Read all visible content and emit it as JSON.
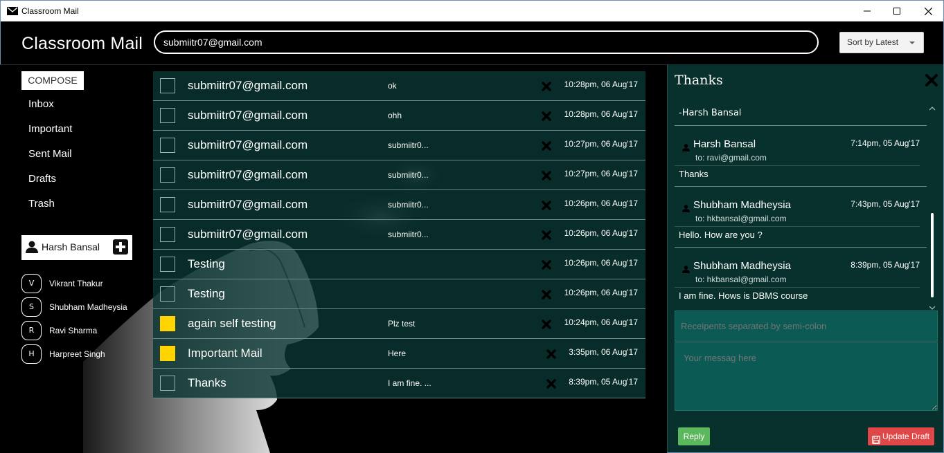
{
  "window": {
    "title": "Classroom Mail",
    "icon": "envelope-icon",
    "controls": [
      "minimize-icon",
      "maximize-icon",
      "close-icon"
    ]
  },
  "header": {
    "brand": "Classroom Mail",
    "search_value": "submiitr07@gmail.com",
    "sort_label": "Sort by Latest"
  },
  "sidebar": {
    "compose_label": "COMPOSE",
    "items": [
      "Inbox",
      "Important",
      "Sent Mail",
      "Drafts",
      "Trash"
    ],
    "current_user": "Harsh Bansal",
    "contacts": [
      {
        "initial": "V",
        "name": "Vikrant Thakur"
      },
      {
        "initial": "S",
        "name": "Shubham Madheysia"
      },
      {
        "initial": "R",
        "name": "Ravi Sharma"
      },
      {
        "initial": "H",
        "name": "Harpreet Singh"
      }
    ]
  },
  "mails": [
    {
      "from": "submiitr07@gmail.com",
      "snippet": "ok",
      "time": "10:28pm, 06 Aug'17",
      "checked": false
    },
    {
      "from": "submiitr07@gmail.com",
      "snippet": "ohh",
      "time": "10:28pm, 06 Aug'17",
      "checked": false
    },
    {
      "from": "submiitr07@gmail.com",
      "snippet": "submiitr0...",
      "time": "10:27pm, 06 Aug'17",
      "checked": false
    },
    {
      "from": "submiitr07@gmail.com",
      "snippet": "submiitr0...",
      "time": "10:27pm, 06 Aug'17",
      "checked": false
    },
    {
      "from": "submiitr07@gmail.com",
      "snippet": "submiitr0...",
      "time": "10:26pm, 06 Aug'17",
      "checked": false
    },
    {
      "from": "submiitr07@gmail.com",
      "snippet": "submiitr0...",
      "time": "10:26pm, 06 Aug'17",
      "checked": false
    },
    {
      "from": "Testing",
      "snippet": "",
      "time": "10:26pm, 06 Aug'17",
      "checked": false
    },
    {
      "from": "Testing",
      "snippet": "",
      "time": "10:26pm, 06 Aug'17",
      "checked": false
    },
    {
      "from": "again self testing",
      "snippet": "Plz test",
      "time": "10:24pm, 06 Aug'17",
      "checked": true
    },
    {
      "from": "Important Mail",
      "snippet": "Here",
      "time": "3:35pm, 06 Aug'17",
      "checked": true
    },
    {
      "from": "Thanks",
      "snippet": "I am fine. ...",
      "time": "8:39pm, 05 Aug'17",
      "checked": false
    }
  ],
  "reading_pane": {
    "subject": "Thanks",
    "signature": "-Harsh Bansal",
    "messages": [
      {
        "from": "Harsh Bansal",
        "to": "to: ravi@gmail.com",
        "time": "7:14pm, 05 Aug'17",
        "body": "Thanks"
      },
      {
        "from": "Shubham Madheysia",
        "to": "to: hkbansal@gmail.com",
        "time": "7:43pm, 05 Aug'17",
        "body": "Hello. How are you ?"
      },
      {
        "from": "Shubham Madheysia",
        "to": "to: hkbansal@gmail.com",
        "time": "8:39pm, 05 Aug'17",
        "body": "I am fine. Hows is DBMS course"
      }
    ],
    "recipients_placeholder": "Receipents separated by semi-colon",
    "message_placeholder": "Your messag here",
    "reply_label": "Reply",
    "update_draft_label": "Update Draft"
  },
  "colors": {
    "row_bg": "#0a3632",
    "panel_bg": "#08302c",
    "input_bg": "#0c5a54",
    "checked": "#ffd400",
    "reply": "#5cb85c",
    "draft": "#e04848"
  }
}
